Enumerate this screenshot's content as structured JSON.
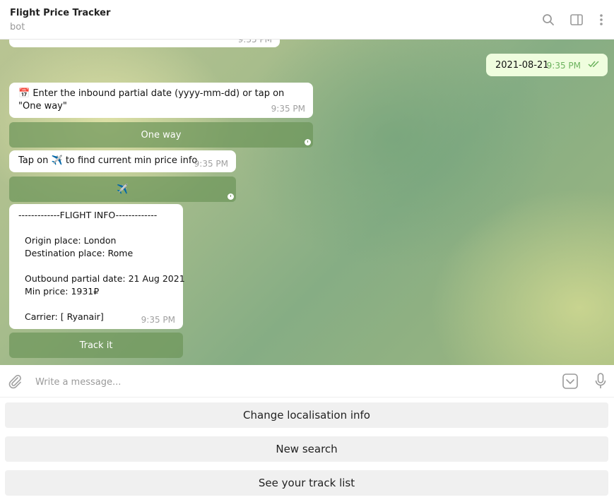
{
  "header": {
    "title": "Flight Price Tracker",
    "subtitle": "bot",
    "icons": [
      "search-icon",
      "sidebar-panel-icon",
      "more-vertical-icon"
    ]
  },
  "messages": {
    "clipped_time": "9:35 PM",
    "outgoing": {
      "text": "2021-08-21",
      "time": "9:35 PM"
    },
    "inbound_prompt": {
      "emoji": "📅",
      "text": "Enter the inbound partial date (yyyy-mm-dd) or tap on \"One way\"",
      "time": "9:35 PM",
      "button": "One way"
    },
    "tap_prompt": {
      "text_before": "Tap on",
      "emoji": "✈️",
      "text_after": "to find current min price info",
      "time": "9:35 PM",
      "button": "✈️"
    },
    "flight_info": {
      "heading": "-------------FLIGHT INFO-------------",
      "origin": "Origin place: London",
      "destination": "Destination place: Rome",
      "outbound": "Outbound partial date: 21 Aug 2021",
      "min_price": "Min price: 1931₽",
      "carrier": "Carrier: [ Ryanair]",
      "time": "9:35 PM",
      "button": "Track it"
    }
  },
  "composer": {
    "placeholder": "Write a message..."
  },
  "reply_keyboard": [
    "Change localisation info",
    "New search",
    "See your track list"
  ],
  "colors": {
    "outgoing_bubble": "#effdde",
    "inline_button": "#7a9f6a",
    "read_check": "#6cb35e"
  }
}
